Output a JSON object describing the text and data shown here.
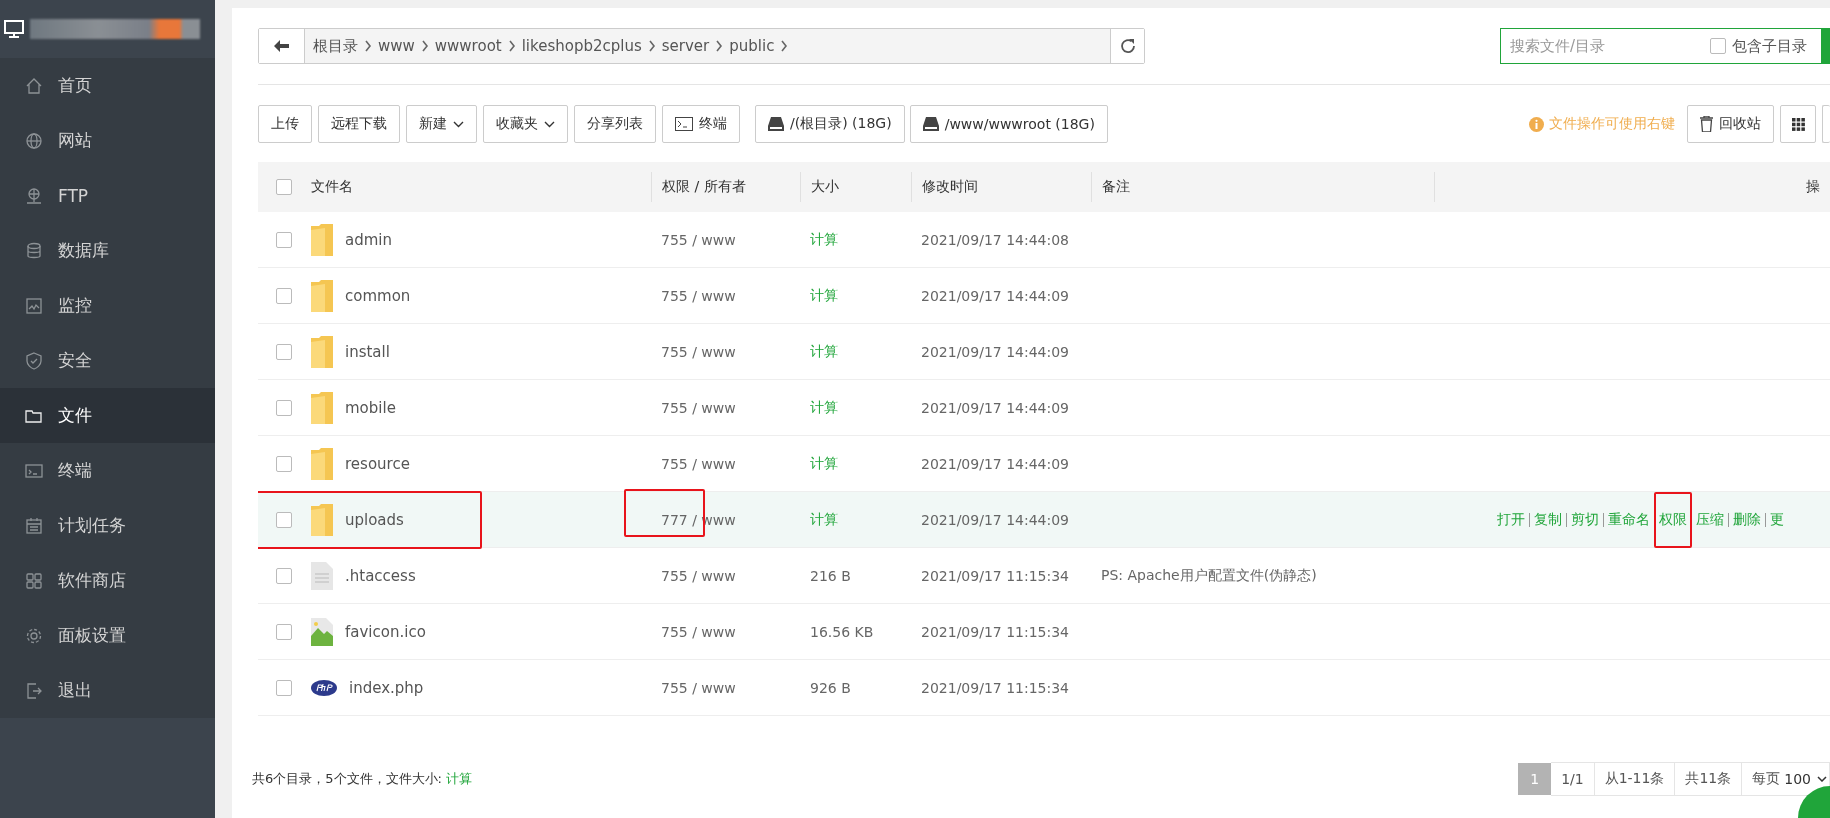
{
  "sidebar": {
    "items": [
      {
        "label": "首页",
        "selected": false
      },
      {
        "label": "网站",
        "selected": false
      },
      {
        "label": "FTP",
        "selected": false
      },
      {
        "label": "数据库",
        "selected": false
      },
      {
        "label": "监控",
        "selected": false
      },
      {
        "label": "安全",
        "selected": false
      },
      {
        "label": "文件",
        "selected": true
      },
      {
        "label": "终端",
        "selected": false
      },
      {
        "label": "计划任务",
        "selected": false
      },
      {
        "label": "软件商店",
        "selected": false
      },
      {
        "label": "面板设置",
        "selected": false
      },
      {
        "label": "退出",
        "selected": false
      }
    ]
  },
  "breadcrumb": {
    "crumbs": [
      "根目录",
      "www",
      "wwwroot",
      "likeshopb2cplus",
      "server",
      "public"
    ]
  },
  "search": {
    "placeholder": "搜索文件/目录",
    "include_subdirs": {
      "label": "包含子目录",
      "checked": false
    }
  },
  "toolbar": {
    "buttons": [
      {
        "label": "上传",
        "kind": "plain"
      },
      {
        "label": "远程下载",
        "kind": "plain"
      },
      {
        "label": "新建",
        "kind": "dropdown"
      },
      {
        "label": "收藏夹",
        "kind": "dropdown"
      },
      {
        "label": "分享列表",
        "kind": "plain"
      },
      {
        "label": "终端",
        "kind": "terminal"
      },
      {
        "label": "/(根目录) (18G)",
        "kind": "disk"
      },
      {
        "label": "/www/wwwroot (18G)",
        "kind": "disk"
      }
    ],
    "tip": "文件操作可使用右键",
    "recycle_bin": "回收站"
  },
  "table": {
    "select_all_checked": false,
    "columns": [
      "文件名",
      "权限 / 所有者",
      "大小",
      "修改时间",
      "备注",
      "操"
    ],
    "rows": [
      {
        "kind": "folder",
        "name": "admin",
        "perm": "755 / www",
        "size": "计算",
        "mtime": "2021/09/17 14:44:08",
        "checked": false,
        "selected": false,
        "name_marked": false,
        "perm_marked": false
      },
      {
        "kind": "folder",
        "name": "common",
        "perm": "755 / www",
        "size": "计算",
        "mtime": "2021/09/17 14:44:09",
        "checked": false,
        "selected": false,
        "name_marked": false,
        "perm_marked": false
      },
      {
        "kind": "folder",
        "name": "install",
        "perm": "755 / www",
        "size": "计算",
        "mtime": "2021/09/17 14:44:09",
        "checked": false,
        "selected": false,
        "name_marked": false,
        "perm_marked": false
      },
      {
        "kind": "folder",
        "name": "mobile",
        "perm": "755 / www",
        "size": "计算",
        "mtime": "2021/09/17 14:44:09",
        "checked": false,
        "selected": false,
        "name_marked": false,
        "perm_marked": false
      },
      {
        "kind": "folder",
        "name": "resource",
        "perm": "755 / www",
        "size": "计算",
        "mtime": "2021/09/17 14:44:09",
        "checked": false,
        "selected": false,
        "name_marked": false,
        "perm_marked": false
      },
      {
        "kind": "folder",
        "name": "uploads",
        "perm": "777 / www",
        "size": "计算",
        "mtime": "2021/09/17 14:44:09",
        "checked": false,
        "selected": true,
        "name_marked": true,
        "perm_marked": true,
        "ops": [
          {
            "label": "打开",
            "marked": false
          },
          {
            "label": "复制",
            "marked": false
          },
          {
            "label": "剪切",
            "marked": false
          },
          {
            "label": "重命名",
            "marked": false
          },
          {
            "label": "权限",
            "marked": true
          },
          {
            "label": "压缩",
            "marked": false
          },
          {
            "label": "删除",
            "marked": false
          },
          {
            "label": "更",
            "marked": false
          }
        ]
      },
      {
        "kind": "file",
        "name": ".htaccess",
        "perm": "755 / www",
        "size": "216 B",
        "mtime": "2021/09/17 11:15:34",
        "note": "PS: Apache用户配置文件(伪静态)",
        "checked": false,
        "selected": false,
        "name_marked": false,
        "perm_marked": false
      },
      {
        "kind": "image",
        "name": "favicon.ico",
        "perm": "755 / www",
        "size": "16.56 KB",
        "mtime": "2021/09/17 11:15:34",
        "checked": false,
        "selected": false,
        "name_marked": false,
        "perm_marked": false
      },
      {
        "kind": "php",
        "name": "index.php",
        "perm": "755 / www",
        "size": "926 B",
        "mtime": "2021/09/17 11:15:34",
        "checked": false,
        "selected": false,
        "name_marked": false,
        "perm_marked": false
      }
    ]
  },
  "footer": {
    "summary": "共6个目录，5个文件，文件大小: ",
    "summary_link": "计算",
    "current_page": "1",
    "info": [
      "1/1",
      "从1-11条",
      "共11条"
    ],
    "per_page_label": "每页",
    "per_page": "100"
  }
}
